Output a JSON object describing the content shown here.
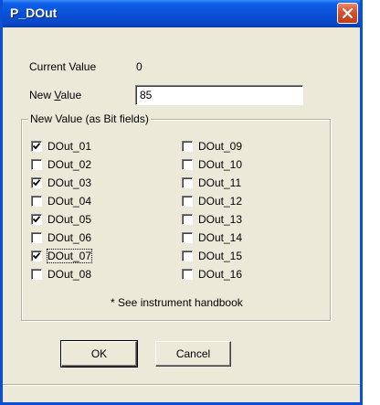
{
  "window": {
    "title": "P_DOut"
  },
  "fields": {
    "current_value_label": "Current Value",
    "current_value": "0",
    "new_value_label_pre": "New ",
    "new_value_label_u": "V",
    "new_value_label_post": "alue",
    "new_value": "85"
  },
  "group": {
    "title": "New Value (as Bit fields)",
    "bits": [
      {
        "label": "DOut_01",
        "checked": true
      },
      {
        "label": "DOut_02",
        "checked": false
      },
      {
        "label": "DOut_03",
        "checked": true
      },
      {
        "label": "DOut_04",
        "checked": false
      },
      {
        "label": "DOut_05",
        "checked": true
      },
      {
        "label": "DOut_06",
        "checked": false
      },
      {
        "label": "DOut_07",
        "checked": true
      },
      {
        "label": "DOut_08",
        "checked": false
      },
      {
        "label": "DOut_09",
        "checked": false
      },
      {
        "label": "DOut_10",
        "checked": false
      },
      {
        "label": "DOut_11",
        "checked": false
      },
      {
        "label": "DOut_12",
        "checked": false
      },
      {
        "label": "DOut_13",
        "checked": false
      },
      {
        "label": "DOut_14",
        "checked": false
      },
      {
        "label": "DOut_15",
        "checked": false
      },
      {
        "label": "DOut_16",
        "checked": false
      }
    ],
    "note": "* See instrument handbook"
  },
  "buttons": {
    "ok": "OK",
    "cancel": "Cancel"
  },
  "icons": {
    "close": "close-icon",
    "check": "checkmark-icon"
  }
}
